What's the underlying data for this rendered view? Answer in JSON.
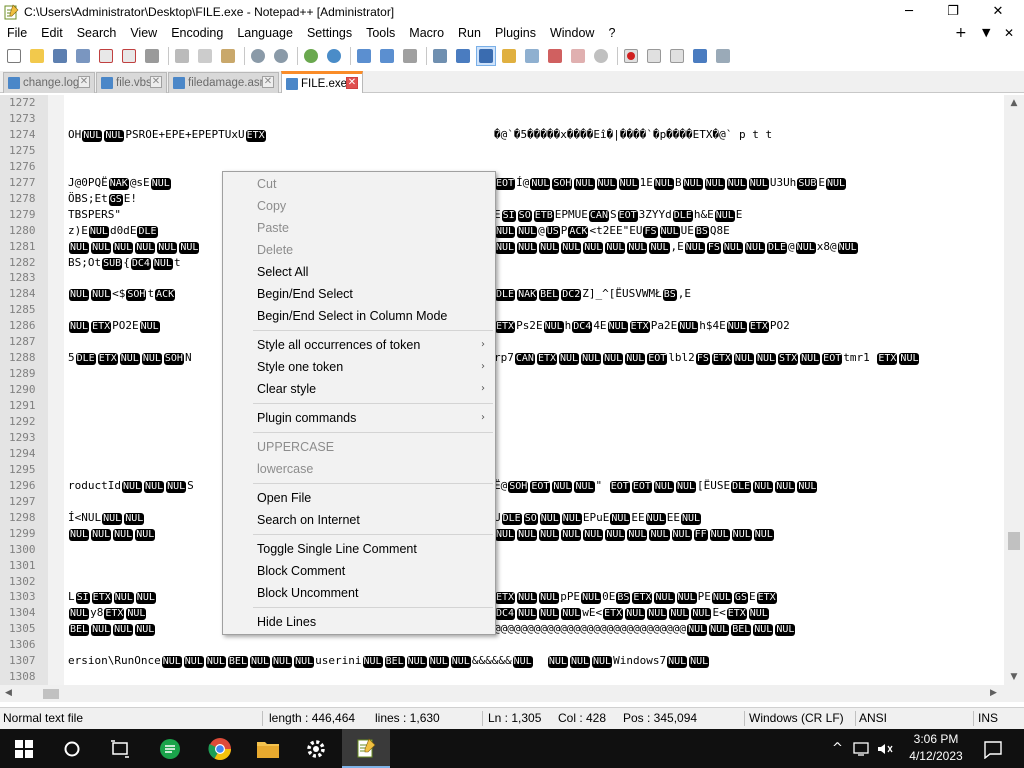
{
  "window": {
    "title": "C:\\Users\\Administrator\\Desktop\\FILE.exe - Notepad++ [Administrator]",
    "minimize": "─",
    "restore": "❐",
    "close": "✕"
  },
  "menubar": {
    "items": [
      "File",
      "Edit",
      "Search",
      "View",
      "Encoding",
      "Language",
      "Settings",
      "Tools",
      "Macro",
      "Run",
      "Plugins",
      "Window",
      "?"
    ],
    "add": "+",
    "dropdown": "▼",
    "close": "✕"
  },
  "tabs": [
    {
      "label": "change.log",
      "active": false
    },
    {
      "label": "file.vbs",
      "active": false
    },
    {
      "label": "filedamage.asm",
      "active": false
    },
    {
      "label": "FILE.exe",
      "active": true
    }
  ],
  "tab_close": "✕",
  "editor": {
    "line_numbers": [
      "1272",
      "1273",
      "1274",
      "1275",
      "1276",
      "1277",
      "1278",
      "1279",
      "1280",
      "1281",
      "1282",
      "1283",
      "1284",
      "1285",
      "1286",
      "1287",
      "1288",
      "1289",
      "1290",
      "1291",
      "1292",
      "1293",
      "1294",
      "1295",
      "1296",
      "1297",
      "1298",
      "1299",
      "1300",
      "1301",
      "1302",
      "1303",
      "1304",
      "1305",
      "1306",
      "1307",
      "1308"
    ],
    "left_text": {
      "1274": "OH NUL NUL P SRO E +E P E +E P E P TU x U ETX ",
      "1277": "J@0PQ Ë NAK @sE NUL",
      "1278": "ÖBS;E t GS E !",
      "1279": "T BSP E RS\"",
      "1280": "z) E NUL d 0d E DLE",
      "1281": "NUL NUL NUL NUL NUL NUL",
      "1282": "BS;Ot SUB { DC4 NUL t",
      "1284": "NUL NUL <$ SOH t ACK",
      "1286": "NUL ETX P O2 E NUL",
      "1288": "5 DLE ETX NUL NUL SOH N",
      "1296": "roductId NUL NUL NUL S",
      "1298": "Í <NUL NUL NUL",
      "1299": "NUL NUL NUL NUL",
      "1303": "L SI ETX NUL NUL",
      "1304": "NUL y 8 ETX NUL",
      "1305": "BEL NUL NUL NUL",
      "1307": "ersion\\RunOnce NUL NUL NUL BEL NUL NUL NUL userini NUL BEL NUL NUL NUL &&&&&& NUL   NUL NUL NUL Windows 7 NUL NUL"
    },
    "right_text": {
      "1274": "�@`�5�����x����Eî�|����`�p����ETX�@`  p  t  t",
      "1277": "EOT Í@ NUL SOH NUL NUL NUL 1E NUL B NUL NUL NUL NUL U 3 Uh SUB E NUL",
      "1278": "",
      "1279": "E SI SO ETB E P M U E CAN S EOT 3 ZYYd DLE h &E NUL E",
      "1280": "NUL NUL @ US P ACK < t2 E E \" E U FS NUL U E BS Q8 E",
      "1281": "NUL NUL NUL NUL NUL NUL NUL NUL , E NUL FS NUL NUL DLE @ NUL x8@ NUL",
      "1284": "DLE NAK BEL DC2 Z] _^[ËU SVW M Ł BS , E",
      "1286": "ETX P s2 E NUL h DC4 4E NUL ETX P a2 E NUL h$4E NUL ETX P O2",
      "1288": "rp7 CAN ETX NUL NUL NUL NUL EOT lbl2 FS ETX NUL NUL STX NUL EOT tmr1  ETX NUL",
      "1296": "Ë@ SOH EOT NUL NUL \"  EOT EOT NUL NUL [ËU S E DLE NUL NUL NUL",
      "1298": "U DLE SO NUL NUL E P u E NUL E E NUL E E NUL",
      "1299": "NUL NUL NUL NUL NUL NUL NUL NUL NUL FF NUL NUL NUL",
      "1303": "ETX NUL NUL p PE NUL 0 E BS ETX NUL NUL PE NUL GS E ETX",
      "1304": "DC4 NUL NUL NUL w E < ETX NUL NUL NUL NUL E < ETX NUL",
      "1305": "@@@@@@@@@@@@@@@@@@@@@@@@@@@@@ NUL NUL BEL NUL NUL"
    }
  },
  "context_menu": {
    "items": [
      {
        "label": "Cut",
        "disabled": true
      },
      {
        "label": "Copy",
        "disabled": true
      },
      {
        "label": "Paste",
        "disabled": true
      },
      {
        "label": "Delete",
        "disabled": true
      },
      {
        "label": "Select All",
        "disabled": false
      },
      {
        "label": "Begin/End Select",
        "disabled": false
      },
      {
        "label": "Begin/End Select in Column Mode",
        "disabled": false
      },
      {
        "label": "Style all occurrences of token",
        "disabled": false,
        "submenu": true
      },
      {
        "label": "Style one token",
        "disabled": false,
        "submenu": true
      },
      {
        "label": "Clear style",
        "disabled": false,
        "submenu": true
      },
      {
        "label": "Plugin commands",
        "disabled": false,
        "submenu": true
      },
      {
        "label": "UPPERCASE",
        "disabled": true
      },
      {
        "label": "lowercase",
        "disabled": true
      },
      {
        "label": "Open File",
        "disabled": false
      },
      {
        "label": "Search on Internet",
        "disabled": false
      },
      {
        "label": "Toggle Single Line Comment",
        "disabled": false
      },
      {
        "label": "Block Comment",
        "disabled": false
      },
      {
        "label": "Block Uncomment",
        "disabled": false
      },
      {
        "label": "Hide Lines",
        "disabled": false
      }
    ],
    "submenu_arrow": "›"
  },
  "statusbar": {
    "filetype": "Normal text file",
    "length": "length : 446,464",
    "lines": "lines : 1,630",
    "ln": "Ln : 1,305",
    "col": "Col : 428",
    "pos": "Pos : 345,094",
    "eol": "Windows (CR LF)",
    "encoding": "ANSI",
    "mode": "INS"
  },
  "taskbar": {
    "time": "3:06 PM",
    "date": "4/12/2023",
    "tray_chevron": "^"
  },
  "colors": {
    "accent_tab": "#fa8c28",
    "gutter": "#e4e4e4",
    "menu_bg": "#f2f2f2",
    "taskbar_bg": "#101010"
  },
  "icons": {
    "app": "notepad-plus-plus-icon",
    "start": "windows-start-icon",
    "search": "search-circle-icon",
    "taskview": "task-view-icon"
  }
}
